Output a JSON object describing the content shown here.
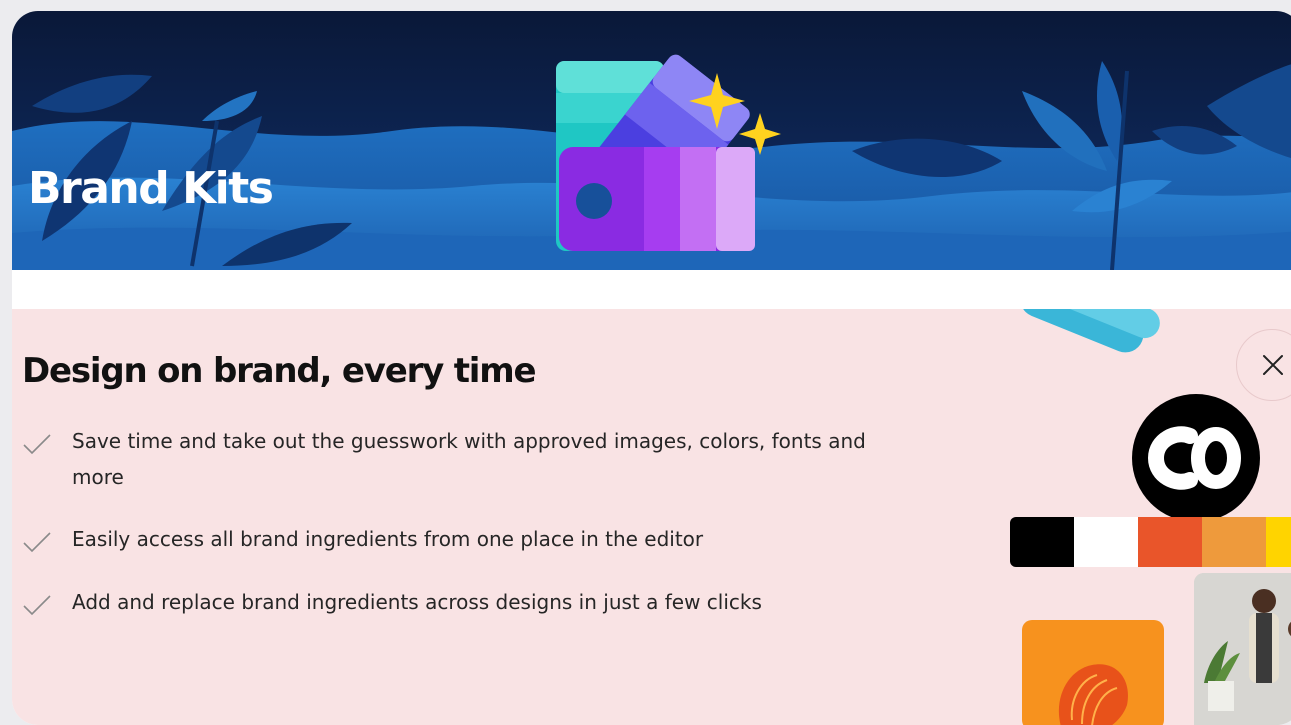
{
  "banner": {
    "title": "Brand Kits"
  },
  "promo": {
    "heading": "Design on brand, every time",
    "features": [
      "Save time and take out the guesswork with approved images, colors, fonts and more",
      "Easily access all brand ingredients from one place in the editor",
      "Add and replace brand ingredients across designs in just a few clicks"
    ],
    "logo_text": "CO",
    "palette": [
      "#000000",
      "#ffffff",
      "#e9552a",
      "#ee9a3c",
      "#ffd400"
    ]
  },
  "icons": {
    "check": "check-icon",
    "close": "close-icon",
    "swatch_book": "color-swatch-icon",
    "sparkle": "sparkle-icon"
  },
  "colors": {
    "banner_dark": "#0d1f4a",
    "banner_blue": "#1a5fae",
    "promo_bg": "#f9e3e4",
    "text": "#111111"
  }
}
